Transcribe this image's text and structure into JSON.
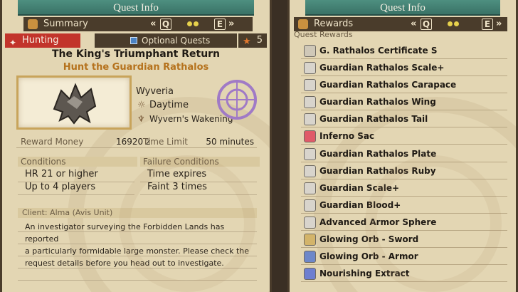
{
  "left": {
    "title": "Quest Info",
    "tab": {
      "label": "Summary",
      "prev_key": "Q",
      "next_key": "E"
    },
    "category": "Hunting",
    "optional_quests_label": "Optional Quests",
    "star_rank": "5",
    "quest_name": "The King's Triumphant Return",
    "objective": "Hunt the Guardian Rathalos",
    "location": "Wyveria",
    "time_of_day": "Daytime",
    "environment": "Wyvern's Wakening",
    "reward_money_label": "Reward Money",
    "reward_money_value": "16920 z",
    "time_limit_label": "Time Limit",
    "time_limit_value": "50 minutes",
    "conditions_label": "Conditions",
    "conditions": [
      "HR 21 or higher",
      "Up to 4 players"
    ],
    "failure_label": "Failure Conditions",
    "failure_conditions": [
      "Time expires",
      "Faint 3 times"
    ],
    "client": "Client: Alma (Avis Unit)",
    "description_lines": [
      "An investigator surveying the Forbidden Lands has reported",
      "a particularly formidable large monster. Please check the",
      "request details before you head out to investigate."
    ]
  },
  "right": {
    "title": "Quest Info",
    "tab": {
      "label": "Rewards",
      "prev_key": "Q",
      "next_key": "E"
    },
    "section_label": "Quest Rewards",
    "rewards": [
      {
        "name": "G. Rathalos Certificate S",
        "icon": "certificate-icon",
        "color": "#cfc8b8"
      },
      {
        "name": "Guardian Rathalos Scale+",
        "icon": "scale-icon",
        "color": "#d8d4cc"
      },
      {
        "name": "Guardian Rathalos Carapace",
        "icon": "carapace-icon",
        "color": "#d8d4cc"
      },
      {
        "name": "Guardian Rathalos Wing",
        "icon": "wing-icon",
        "color": "#d8d4cc"
      },
      {
        "name": "Guardian Rathalos Tail",
        "icon": "tail-icon",
        "color": "#d8d4cc"
      },
      {
        "name": "Inferno Sac",
        "icon": "sac-icon",
        "color": "#e05a68"
      },
      {
        "name": "Guardian Rathalos Plate",
        "icon": "plate-icon",
        "color": "#d8d4cc"
      },
      {
        "name": "Guardian Rathalos Ruby",
        "icon": "ruby-icon",
        "color": "#d8d4cc"
      },
      {
        "name": "Guardian Scale+",
        "icon": "scale-icon",
        "color": "#d8d4cc"
      },
      {
        "name": "Guardian Blood+",
        "icon": "blood-icon",
        "color": "#d8d4cc"
      },
      {
        "name": "Advanced Armor Sphere",
        "icon": "sphere-icon",
        "color": "#d8d4cc"
      },
      {
        "name": "Glowing Orb - Sword",
        "icon": "orb-sword-icon",
        "color": "#d3b46a"
      },
      {
        "name": "Glowing Orb - Armor",
        "icon": "orb-armor-icon",
        "color": "#6d87c9"
      },
      {
        "name": "Nourishing Extract",
        "icon": "extract-icon",
        "color": "#6e7fd0"
      }
    ]
  },
  "colors": {
    "title_bar": "#4e8f80",
    "hunting_tag": "#c2342b",
    "objective_text": "#b5721d",
    "parchment": "#e3d6b3"
  }
}
